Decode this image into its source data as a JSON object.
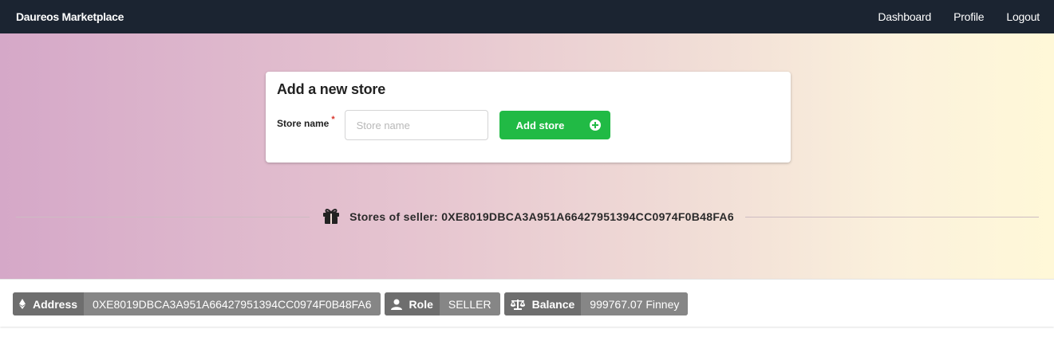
{
  "navbar": {
    "brand": "Daureos Marketplace",
    "links": [
      "Dashboard",
      "Profile",
      "Logout"
    ]
  },
  "store_form": {
    "title": "Add a new store",
    "field_label": "Store name",
    "required_mark": "*",
    "placeholder": "Store name",
    "value": "",
    "submit_label": "Add store",
    "submit_icon": "plus-circle-icon"
  },
  "stores_divider": {
    "icon": "gift-icon",
    "text": "Stores of seller: 0XE8019DBCA3A951A66427951394CC0974F0B48FA6"
  },
  "info_labels": [
    {
      "icon": "ethereum-icon",
      "key": "Address",
      "value": "0XE8019DBCA3A951A66427951394CC0974F0B48FA6"
    },
    {
      "icon": "user-icon",
      "key": "Role",
      "value": "SELLER"
    },
    {
      "icon": "balance-scale-icon",
      "key": "Balance",
      "value": "999767.07 Finney"
    }
  ],
  "colors": {
    "navbar_bg": "#1b2431",
    "button_green": "#21ba45",
    "label_grey": "#767676",
    "required_red": "#d9342b"
  }
}
